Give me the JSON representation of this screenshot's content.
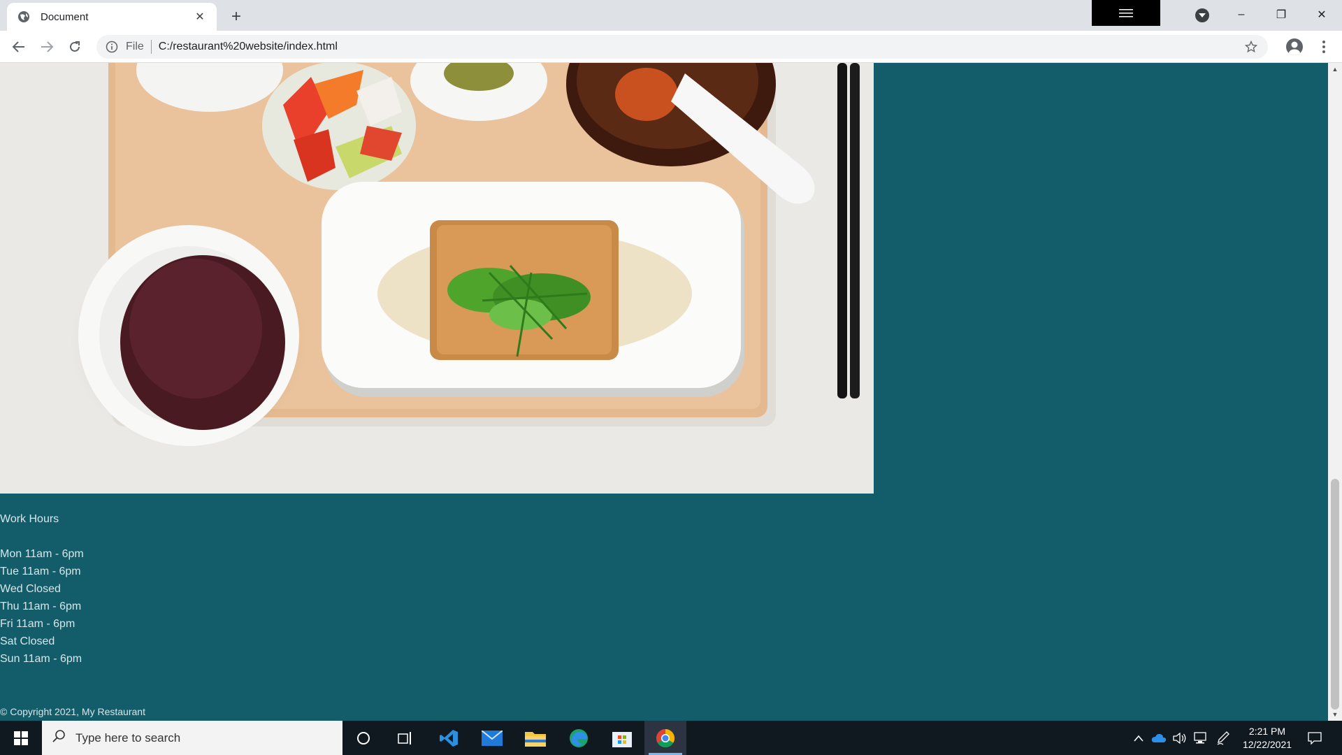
{
  "browser": {
    "tab_title": "Document",
    "tab_close": "✕",
    "new_tab": "+",
    "url_scheme": "File",
    "url": "C:/restaurant%20website/index.html",
    "window_controls": {
      "minimize": "–",
      "restore": "❐",
      "close": "✕"
    }
  },
  "page": {
    "hero_image": "japanese-meal-tray-photo",
    "work_hours": {
      "heading": "Work Hours",
      "days": [
        "Mon 11am - 6pm",
        "Tue 11am - 6pm",
        "Wed Closed",
        "Thu 11am - 6pm",
        "Fri 11am - 6pm",
        "Sat Closed",
        "Sun 11am - 6pm"
      ]
    },
    "copyright": "© Copyright 2021, My Restaurant",
    "background_color": "#135d6b"
  },
  "taskbar": {
    "search_placeholder": "Type here to search",
    "time": "2:21 PM",
    "date": "12/22/2021"
  },
  "colors": {
    "accent": "#135d6b",
    "taskbar": "#101820"
  }
}
